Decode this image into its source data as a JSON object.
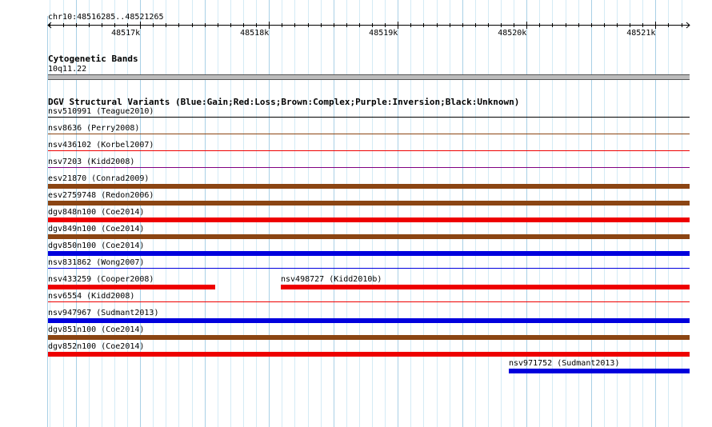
{
  "ruler": {
    "locus": "chr10:48516285..48521265",
    "ticks": [
      "48517k",
      "48518k",
      "48519k",
      "48520k",
      "48521k"
    ]
  },
  "cytoband_track": {
    "title": "Cytogenetic Bands",
    "band": "10q11.22"
  },
  "dgv_track": {
    "title": "DGV Structural Variants (Blue:Gain;Red:Loss;Brown:Complex;Purple:Inversion;Black:Unknown)",
    "colors": {
      "gain": "#0000dd",
      "loss": "#ee0000",
      "complex": "#8b4513",
      "inversion": "#800080",
      "unknown": "#000000"
    },
    "rows": [
      {
        "features": [
          {
            "label": "nsv510991 (Teague2010)",
            "color": "#000000",
            "thin": true
          }
        ]
      },
      {
        "features": [
          {
            "label": "nsv8636 (Perry2008)",
            "color": "#8b4513",
            "thin": true
          }
        ]
      },
      {
        "features": [
          {
            "label": "nsv436102 (Korbel2007)",
            "color": "#ee0000",
            "thin": true
          }
        ]
      },
      {
        "features": [
          {
            "label": "nsv7203 (Kidd2008)",
            "color": "#800080",
            "thin": true
          }
        ]
      },
      {
        "features": [
          {
            "label": "esv21870 (Conrad2009)",
            "color": "#8b4513"
          }
        ]
      },
      {
        "features": [
          {
            "label": "esv2759748 (Redon2006)",
            "color": "#8b4513"
          }
        ]
      },
      {
        "features": [
          {
            "label": "dgv848n100 (Coe2014)",
            "color": "#ee0000"
          }
        ]
      },
      {
        "features": [
          {
            "label": "dgv849n100 (Coe2014)",
            "color": "#8b4513"
          }
        ]
      },
      {
        "features": [
          {
            "label": "dgv850n100 (Coe2014)",
            "color": "#0000dd"
          }
        ]
      },
      {
        "features": [
          {
            "label": "nsv831862 (Wong2007)",
            "color": "#0000dd",
            "thin": true
          }
        ]
      },
      {
        "features": [
          {
            "label": "nsv433259 (Cooper2008)",
            "color": "#ee0000",
            "end": 48517580
          },
          {
            "label": "nsv498727 (Kidd2010b)",
            "color": "#ee0000",
            "start": 48518095
          }
        ]
      },
      {
        "features": [
          {
            "label": "nsv6554 (Kidd2008)",
            "color": "#ee0000",
            "thin": true
          }
        ]
      },
      {
        "features": [
          {
            "label": "nsv947967 (Sudmant2013)",
            "color": "#0000dd"
          }
        ]
      },
      {
        "features": [
          {
            "label": "dgv851n100 (Coe2014)",
            "color": "#8b4513"
          }
        ]
      },
      {
        "features": [
          {
            "label": "dgv852n100 (Coe2014)",
            "color": "#ee0000"
          }
        ]
      },
      {
        "features": [
          {
            "label": "nsv971752 (Sudmant2013)",
            "color": "#0000dd",
            "start": 48519860
          }
        ]
      }
    ]
  }
}
